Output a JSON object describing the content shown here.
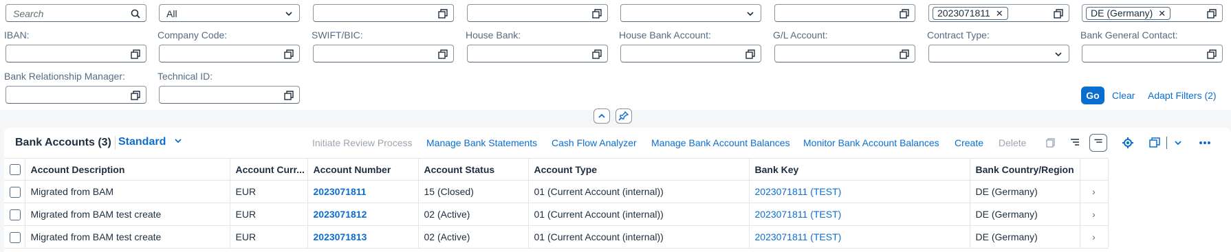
{
  "filters": {
    "row1": [
      {
        "placeholder": "Search",
        "value": ""
      },
      {
        "value": "All"
      },
      {
        "value": ""
      },
      {
        "value": ""
      },
      {
        "value": ""
      },
      {
        "value": ""
      },
      {
        "token": "2023071811"
      },
      {
        "token": "DE (Germany)"
      }
    ],
    "labels_row2": [
      "IBAN:",
      "Company Code:",
      "SWIFT/BIC:",
      "House Bank:",
      "House Bank Account:",
      "G/L Account:",
      "Contract Type:",
      "Bank General Contact:"
    ],
    "labels_row3": [
      "Bank Relationship Manager:",
      "Technical ID:"
    ],
    "go": "Go",
    "clear": "Clear",
    "adapt": "Adapt Filters (2)"
  },
  "toolbar": {
    "title": "Bank Accounts (3)",
    "variant": "Standard",
    "actions": [
      "Initiate Review Process",
      "Manage Bank Statements",
      "Cash Flow Analyzer",
      "Manage Bank Account Balances",
      "Monitor Bank Account Balances",
      "Create",
      "Delete"
    ],
    "icons": [
      "copy-icon",
      "sort-ascending-icon",
      "sort-descending-icon",
      "gear-icon",
      "export-icon",
      "chevron-down-icon",
      "overflow-icon"
    ]
  },
  "table": {
    "columns": [
      "Account Description",
      "Account Curr...",
      "Account Number",
      "Account Status",
      "Account Type",
      "Bank Key",
      "Bank Country/Region"
    ],
    "rows": [
      [
        "Migrated from BAM",
        "EUR",
        "2023071811",
        "15 (Closed)",
        "01 (Current Account (internal))",
        "2023071811 (TEST)",
        "DE (Germany)"
      ],
      [
        "Migrated from BAM test create",
        "EUR",
        "2023071812",
        "02 (Active)",
        "01 (Current Account (internal))",
        "2023071811 (TEST)",
        "DE (Germany)"
      ],
      [
        "Migrated from BAM test create",
        "EUR",
        "2023071813",
        "02 (Active)",
        "01 (Current Account (internal))",
        "2023071811 (TEST)",
        "DE (Germany)"
      ]
    ]
  },
  "colors": {
    "accent": "#0a6ed1",
    "text": "#1d2d3e",
    "label": "#556b82",
    "disabled": "#9aa5b1"
  }
}
